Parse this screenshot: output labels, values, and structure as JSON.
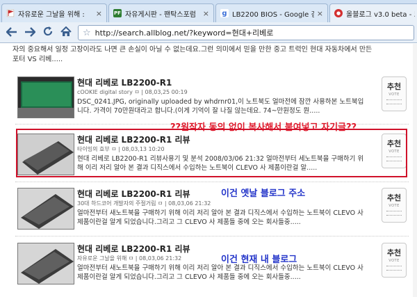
{
  "browser": {
    "tabs": [
      {
        "title": "자유로운 그날을 위해 :",
        "favicon": "bookmark-flag-icon",
        "color": "#c62828"
      },
      {
        "title": "자유게시판 - 팬탁스포럼",
        "favicon": "pf-logo-icon",
        "color": "#2e7d32"
      },
      {
        "title": "LB2200 BIOS - Google 검색",
        "favicon": "google-g-icon",
        "color": "#3b6fd8"
      },
      {
        "title": "올블로그 v3.0 beta - 모든",
        "favicon": "allblog-icon",
        "color": "#d32f2f"
      }
    ],
    "toolbar": {
      "url": "http://search.allblog.net/?keyword=현대+리베로"
    }
  },
  "page": {
    "top_snippet": "자의 중요해서 일정 고장이라도 나면 큰 손실이 아닐 수 없는데요.그런 의미에서 믿을 만한 중고 트럭인 현대 자동차에서 만든 포터 VS 리베.....",
    "posts": [
      {
        "title": "현대 리베로 LB2200-R1",
        "meta": "cOOKIE digital story ㅁ | 08,03,25 00:19",
        "desc": "DSC_0241.JPG, originally uploaded by whdrnr01,이 노트북도 얼마전에 잠깐 사용하본 노트북입니다. 가격이 70만원대라고 합니다.(이게 기억이 잘 나질 않는데요. 74~만원정도 뭔.....",
        "recommend": "추천",
        "vote": "VOTE"
      },
      {
        "title": "현대 리베로 LB2200-R1 리뷰",
        "meta": "타이밍의 효부 ㅁ | 08,03,13 10:20",
        "desc": "현대 리베로 LB2200-R1 리뷰사용기 및 분석 2008/03/06 21:32 얼마전부터 세노트북을 구매하기 위해 이리 저리 알아 본 결과 디직스에서 수입하는 노트북이 CLEVO 사 제품이란걸 알.....",
        "recommend": "추천",
        "vote": "VOTE"
      },
      {
        "title": "현대 리베로 LB2200-R1 리뷰",
        "meta": "30대 하드코어 개발자의 주절거림 ㅁ | 08,03,06 21:32",
        "desc": "얼마전부터 새노트북을 구매하기 위해 이리 저리 알아 본 결과 디직스에서 수입하는 노트북이 CLEVO 사 제품이란걸 알게 되었습니다.그리고 그 CLEVO 사 제품들 중에 오는 회사들중.....",
        "recommend": "추천",
        "vote": "VOTE"
      },
      {
        "title": "현대 리베로 LB2200-R1 리뷰",
        "meta": "자유로운 그날을 위해 ㅁ | 08,03,06 21:32",
        "desc": "얼마전부터 새노트북을 구매하기 위해 이리 저리 알아 본 결과 디직스에서 수입하는 노트북이 CLEVO 사 제품이란걸 알게 되었습니다.그리고 그 CLEVO 사 제품들 중에 오는 회사들중.....",
        "recommend": "추천",
        "vote": "VOTE"
      }
    ],
    "annotations": {
      "copied": "??원작자 동의 없이 복사해서 붙여넣고 자기글??",
      "old_blog": "이건 옛날 블로그 주소",
      "current_blog": "이건 현재 내 블로그"
    },
    "colors": {
      "highlight": "#d0112a",
      "annotation_red": "#e01a2c",
      "annotation_blue": "#2334c9"
    }
  }
}
